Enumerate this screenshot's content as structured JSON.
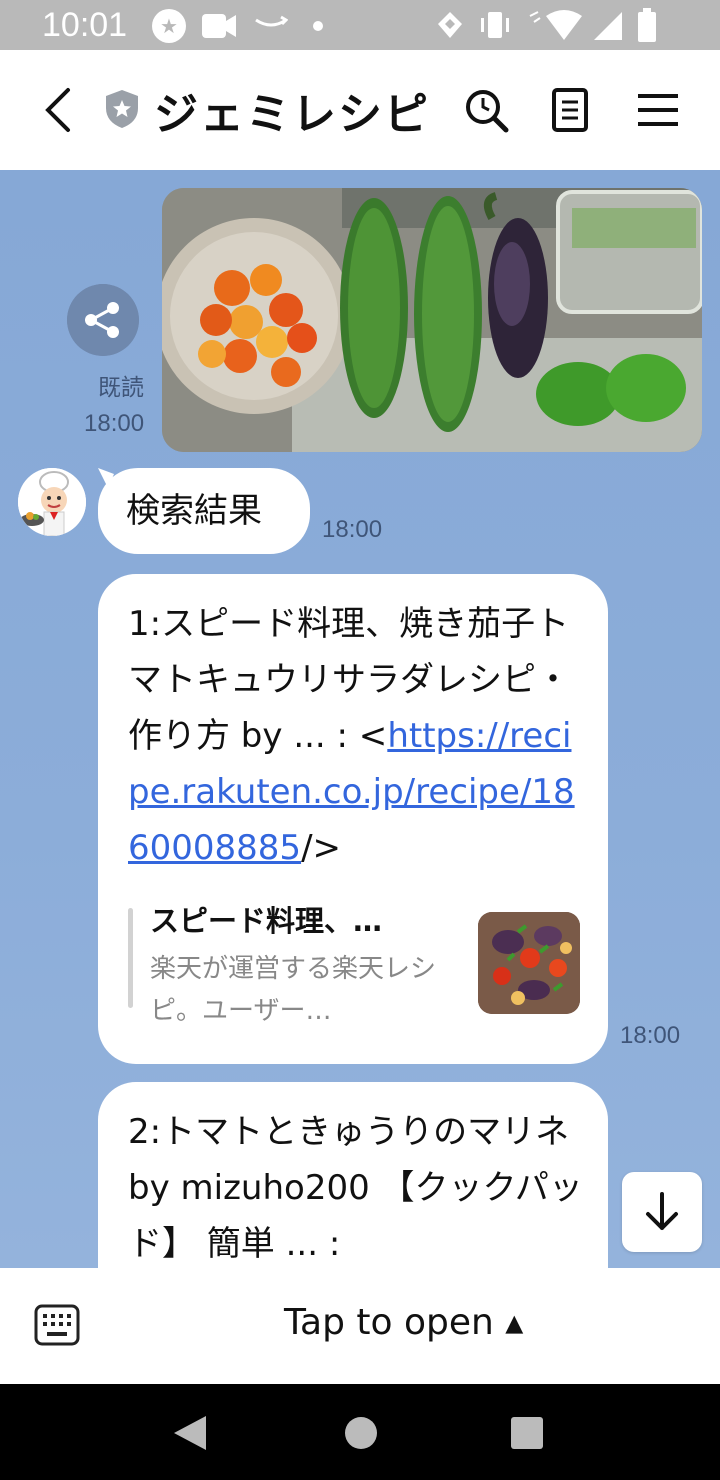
{
  "status_bar": {
    "time": "10:01",
    "icons": [
      "notification-icon",
      "video-icon",
      "amazon-icon",
      "dot-icon",
      "data-saver-icon",
      "vibrate-icon",
      "wifi-icon",
      "signal-icon",
      "battery-icon"
    ]
  },
  "header": {
    "title": "ジェミレシピ",
    "icons": [
      "back-icon",
      "shield-icon",
      "search-icon",
      "notes-icon",
      "menu-icon"
    ]
  },
  "chat": {
    "sent_photo": {
      "read_label": "既読",
      "time": "18:00"
    },
    "bot_message_1": {
      "text": "検索結果",
      "time": "18:00"
    },
    "bot_message_2": {
      "text_before_link": "1:スピード料理、焼き茄子トマトキュウリサラダレシピ・作り方 by ... : <",
      "link": "https://recipe.rakuten.co.jp/recipe/1860008885",
      "text_after_link": "/>",
      "preview_title": "スピード料理、…",
      "preview_desc": "楽天が運営する楽天レシピ。ユーザー…",
      "time": "18:00"
    },
    "bot_message_3": {
      "text": "2:トマトときゅうりのマリネ by mizuho200 【クックパッド】 簡単 ... :"
    }
  },
  "bottom_bar": {
    "tap_to_open": "Tap to open ▴"
  },
  "colors": {
    "chat_background": "#8aabd8",
    "link": "#3366dd",
    "header_background": "#ffffff"
  }
}
